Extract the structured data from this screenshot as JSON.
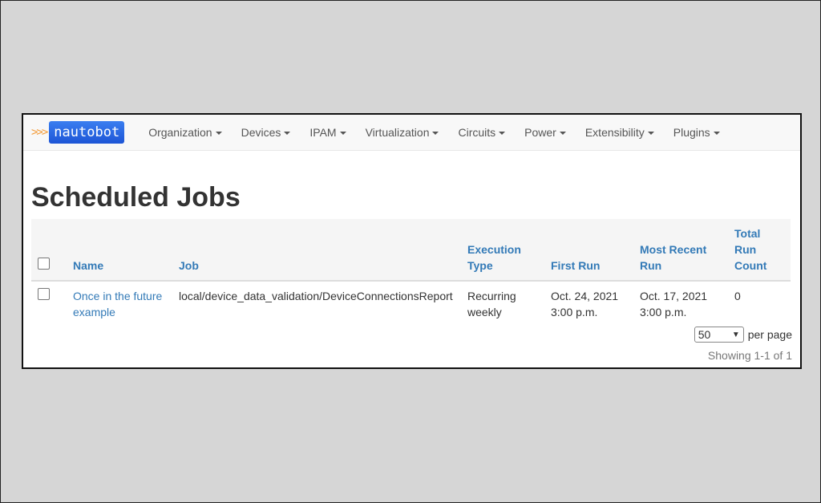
{
  "brand": {
    "chevrons": ">>>",
    "name": "nautobot"
  },
  "nav": {
    "items": [
      {
        "label": "Organization"
      },
      {
        "label": "Devices"
      },
      {
        "label": "IPAM"
      },
      {
        "label": "Virtualization"
      },
      {
        "label": "Circuits"
      },
      {
        "label": "Power"
      },
      {
        "label": "Extensibility"
      },
      {
        "label": "Plugins"
      }
    ]
  },
  "page": {
    "title": "Scheduled Jobs"
  },
  "table": {
    "columns": {
      "name": "Name",
      "job": "Job",
      "execution_type": "Execution Type",
      "first_run": "First Run",
      "most_recent_run": "Most Recent Run",
      "total_run_count": "Total Run Count"
    },
    "rows": [
      {
        "name": "Once in the future example",
        "job": "local/device_data_validation/DeviceConnectionsReport",
        "execution_type": "Recurring weekly",
        "first_run": "Oct. 24, 2021 3:00 p.m.",
        "most_recent_run": "Oct. 17, 2021 3:00 p.m.",
        "total_run_count": "0"
      }
    ]
  },
  "pagination": {
    "per_page_value": "50",
    "per_page_label": "per page",
    "showing": "Showing 1-1 of 1"
  },
  "colors": {
    "link": "#337ab7",
    "brand_bg": "#1d55d6",
    "brand_chevron": "#f39c3a"
  }
}
